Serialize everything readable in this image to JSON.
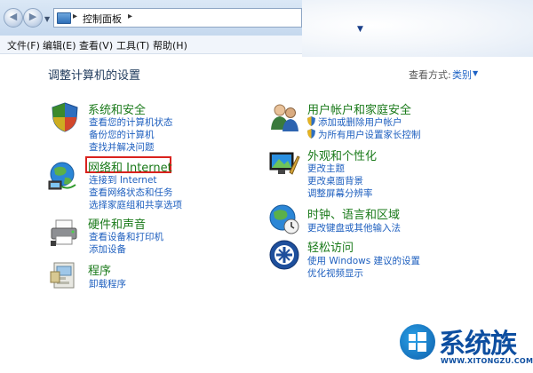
{
  "address_bar": {
    "breadcrumb": "控制面板",
    "separator": "▸"
  },
  "menu": [
    "文件(F)",
    "编辑(E)",
    "查看(V)",
    "工具(T)",
    "帮助(H)"
  ],
  "page_title": "调整计算机的设置",
  "view": {
    "label": "查看方式:",
    "value": "类别"
  },
  "left_categories": [
    {
      "title": "系统和安全",
      "icon": "shield-icon",
      "links": [
        "查看您的计算机状态",
        "备份您的计算机",
        "查找并解决问题"
      ]
    },
    {
      "title": "网络和 Internet",
      "icon": "network-icon",
      "links": [
        "连接到 Internet",
        "查看网络状态和任务",
        "选择家庭组和共享选项"
      ]
    },
    {
      "title": "硬件和声音",
      "icon": "printer-icon",
      "links": [
        "查看设备和打印机",
        "添加设备"
      ]
    },
    {
      "title": "程序",
      "icon": "programs-icon",
      "links": [
        "卸载程序"
      ]
    }
  ],
  "right_categories": [
    {
      "title": "用户帐户和家庭安全",
      "icon": "users-icon",
      "links": [
        "添加或删除用户帐户",
        "为所有用户设置家长控制"
      ]
    },
    {
      "title": "外观和个性化",
      "icon": "display-icon",
      "links": [
        "更改主题",
        "更改桌面背景",
        "调整屏幕分辨率"
      ]
    },
    {
      "title": "时钟、语言和区域",
      "icon": "globe-clock-icon",
      "links": [
        "更改键盘或其他输入法"
      ]
    },
    {
      "title": "轻松访问",
      "icon": "accessibility-icon",
      "links": [
        "使用 Windows 建议的设置",
        "优化视频显示"
      ]
    }
  ],
  "watermark": {
    "text": "系统族",
    "url": "WWW.XITONGZU.COM"
  },
  "colors": {
    "link": "#1e5fbf",
    "category_title": "#1a7a1a",
    "highlight": "#d9221e"
  }
}
